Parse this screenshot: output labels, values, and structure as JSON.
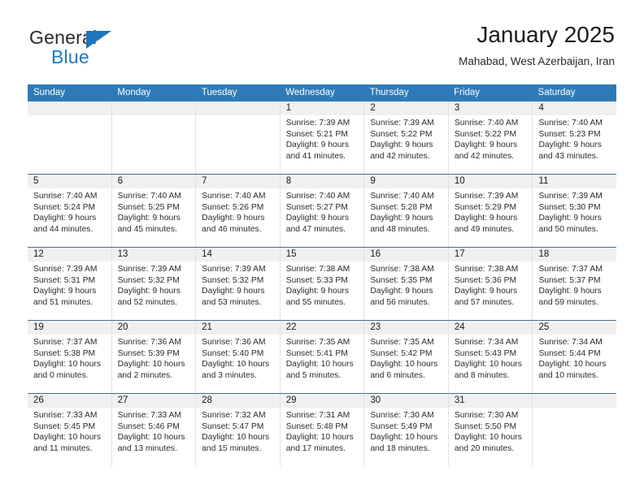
{
  "brand": {
    "name_top": "General",
    "name_bottom": "Blue",
    "triangle_icon": "triangle-icon",
    "accent_color": "#1d7cc4",
    "top_text_color": "#2b2b2b"
  },
  "header": {
    "title": "January 2025",
    "subtitle": "Mahabad, West Azerbaijan, Iran"
  },
  "theme": {
    "header_row_bg": "#2e7ab8",
    "header_row_text": "#ffffff",
    "daynum_band_bg": "#f0f0f0",
    "week_divider": "#4a6d8c",
    "cell_divider": "#e2e2e2"
  },
  "weekday_headers": [
    "Sunday",
    "Monday",
    "Tuesday",
    "Wednesday",
    "Thursday",
    "Friday",
    "Saturday"
  ],
  "weeks": [
    [
      {
        "day": "",
        "lines": []
      },
      {
        "day": "",
        "lines": []
      },
      {
        "day": "",
        "lines": []
      },
      {
        "day": "1",
        "lines": [
          "Sunrise: 7:39 AM",
          "Sunset: 5:21 PM",
          "Daylight: 9 hours",
          "and 41 minutes."
        ]
      },
      {
        "day": "2",
        "lines": [
          "Sunrise: 7:39 AM",
          "Sunset: 5:22 PM",
          "Daylight: 9 hours",
          "and 42 minutes."
        ]
      },
      {
        "day": "3",
        "lines": [
          "Sunrise: 7:40 AM",
          "Sunset: 5:22 PM",
          "Daylight: 9 hours",
          "and 42 minutes."
        ]
      },
      {
        "day": "4",
        "lines": [
          "Sunrise: 7:40 AM",
          "Sunset: 5:23 PM",
          "Daylight: 9 hours",
          "and 43 minutes."
        ]
      }
    ],
    [
      {
        "day": "5",
        "lines": [
          "Sunrise: 7:40 AM",
          "Sunset: 5:24 PM",
          "Daylight: 9 hours",
          "and 44 minutes."
        ]
      },
      {
        "day": "6",
        "lines": [
          "Sunrise: 7:40 AM",
          "Sunset: 5:25 PM",
          "Daylight: 9 hours",
          "and 45 minutes."
        ]
      },
      {
        "day": "7",
        "lines": [
          "Sunrise: 7:40 AM",
          "Sunset: 5:26 PM",
          "Daylight: 9 hours",
          "and 46 minutes."
        ]
      },
      {
        "day": "8",
        "lines": [
          "Sunrise: 7:40 AM",
          "Sunset: 5:27 PM",
          "Daylight: 9 hours",
          "and 47 minutes."
        ]
      },
      {
        "day": "9",
        "lines": [
          "Sunrise: 7:40 AM",
          "Sunset: 5:28 PM",
          "Daylight: 9 hours",
          "and 48 minutes."
        ]
      },
      {
        "day": "10",
        "lines": [
          "Sunrise: 7:39 AM",
          "Sunset: 5:29 PM",
          "Daylight: 9 hours",
          "and 49 minutes."
        ]
      },
      {
        "day": "11",
        "lines": [
          "Sunrise: 7:39 AM",
          "Sunset: 5:30 PM",
          "Daylight: 9 hours",
          "and 50 minutes."
        ]
      }
    ],
    [
      {
        "day": "12",
        "lines": [
          "Sunrise: 7:39 AM",
          "Sunset: 5:31 PM",
          "Daylight: 9 hours",
          "and 51 minutes."
        ]
      },
      {
        "day": "13",
        "lines": [
          "Sunrise: 7:39 AM",
          "Sunset: 5:32 PM",
          "Daylight: 9 hours",
          "and 52 minutes."
        ]
      },
      {
        "day": "14",
        "lines": [
          "Sunrise: 7:39 AM",
          "Sunset: 5:32 PM",
          "Daylight: 9 hours",
          "and 53 minutes."
        ]
      },
      {
        "day": "15",
        "lines": [
          "Sunrise: 7:38 AM",
          "Sunset: 5:33 PM",
          "Daylight: 9 hours",
          "and 55 minutes."
        ]
      },
      {
        "day": "16",
        "lines": [
          "Sunrise: 7:38 AM",
          "Sunset: 5:35 PM",
          "Daylight: 9 hours",
          "and 56 minutes."
        ]
      },
      {
        "day": "17",
        "lines": [
          "Sunrise: 7:38 AM",
          "Sunset: 5:36 PM",
          "Daylight: 9 hours",
          "and 57 minutes."
        ]
      },
      {
        "day": "18",
        "lines": [
          "Sunrise: 7:37 AM",
          "Sunset: 5:37 PM",
          "Daylight: 9 hours",
          "and 59 minutes."
        ]
      }
    ],
    [
      {
        "day": "19",
        "lines": [
          "Sunrise: 7:37 AM",
          "Sunset: 5:38 PM",
          "Daylight: 10 hours",
          "and 0 minutes."
        ]
      },
      {
        "day": "20",
        "lines": [
          "Sunrise: 7:36 AM",
          "Sunset: 5:39 PM",
          "Daylight: 10 hours",
          "and 2 minutes."
        ]
      },
      {
        "day": "21",
        "lines": [
          "Sunrise: 7:36 AM",
          "Sunset: 5:40 PM",
          "Daylight: 10 hours",
          "and 3 minutes."
        ]
      },
      {
        "day": "22",
        "lines": [
          "Sunrise: 7:35 AM",
          "Sunset: 5:41 PM",
          "Daylight: 10 hours",
          "and 5 minutes."
        ]
      },
      {
        "day": "23",
        "lines": [
          "Sunrise: 7:35 AM",
          "Sunset: 5:42 PM",
          "Daylight: 10 hours",
          "and 6 minutes."
        ]
      },
      {
        "day": "24",
        "lines": [
          "Sunrise: 7:34 AM",
          "Sunset: 5:43 PM",
          "Daylight: 10 hours",
          "and 8 minutes."
        ]
      },
      {
        "day": "25",
        "lines": [
          "Sunrise: 7:34 AM",
          "Sunset: 5:44 PM",
          "Daylight: 10 hours",
          "and 10 minutes."
        ]
      }
    ],
    [
      {
        "day": "26",
        "lines": [
          "Sunrise: 7:33 AM",
          "Sunset: 5:45 PM",
          "Daylight: 10 hours",
          "and 11 minutes."
        ]
      },
      {
        "day": "27",
        "lines": [
          "Sunrise: 7:33 AM",
          "Sunset: 5:46 PM",
          "Daylight: 10 hours",
          "and 13 minutes."
        ]
      },
      {
        "day": "28",
        "lines": [
          "Sunrise: 7:32 AM",
          "Sunset: 5:47 PM",
          "Daylight: 10 hours",
          "and 15 minutes."
        ]
      },
      {
        "day": "29",
        "lines": [
          "Sunrise: 7:31 AM",
          "Sunset: 5:48 PM",
          "Daylight: 10 hours",
          "and 17 minutes."
        ]
      },
      {
        "day": "30",
        "lines": [
          "Sunrise: 7:30 AM",
          "Sunset: 5:49 PM",
          "Daylight: 10 hours",
          "and 18 minutes."
        ]
      },
      {
        "day": "31",
        "lines": [
          "Sunrise: 7:30 AM",
          "Sunset: 5:50 PM",
          "Daylight: 10 hours",
          "and 20 minutes."
        ]
      },
      {
        "day": "",
        "lines": []
      }
    ]
  ]
}
